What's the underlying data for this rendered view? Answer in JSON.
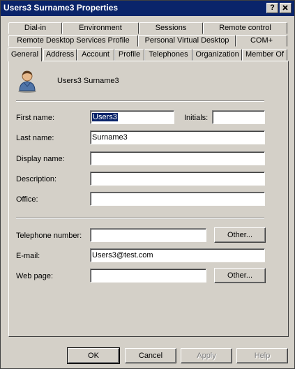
{
  "window": {
    "title": "Users3 Surname3 Properties",
    "help_button": "?",
    "close_button": "X"
  },
  "tabs": {
    "row1": [
      "Dial-in",
      "Environment",
      "Sessions",
      "Remote control"
    ],
    "row2": [
      "Remote Desktop Services Profile",
      "Personal Virtual Desktop",
      "COM+"
    ],
    "row3": [
      "General",
      "Address",
      "Account",
      "Profile",
      "Telephones",
      "Organization",
      "Member Of"
    ],
    "active": "General"
  },
  "general": {
    "display_title": "Users3 Surname3",
    "first_name_label": "First name:",
    "first_name_value": "Users3",
    "initials_label": "Initials:",
    "initials_value": "",
    "last_name_label": "Last name:",
    "last_name_value": "Surname3",
    "display_name_label": "Display name:",
    "display_name_value": "",
    "description_label": "Description:",
    "description_value": "",
    "office_label": "Office:",
    "office_value": "",
    "telephone_label": "Telephone number:",
    "telephone_value": "",
    "telephone_other": "Other...",
    "email_label": "E-mail:",
    "email_value": "Users3@test.com",
    "webpage_label": "Web page:",
    "webpage_value": "",
    "webpage_other": "Other..."
  },
  "footer": {
    "ok": "OK",
    "cancel": "Cancel",
    "apply": "Apply",
    "help": "Help"
  },
  "colors": {
    "titlebar": "#0a246a",
    "face": "#d4d0c8",
    "selection": "#0a246a"
  }
}
